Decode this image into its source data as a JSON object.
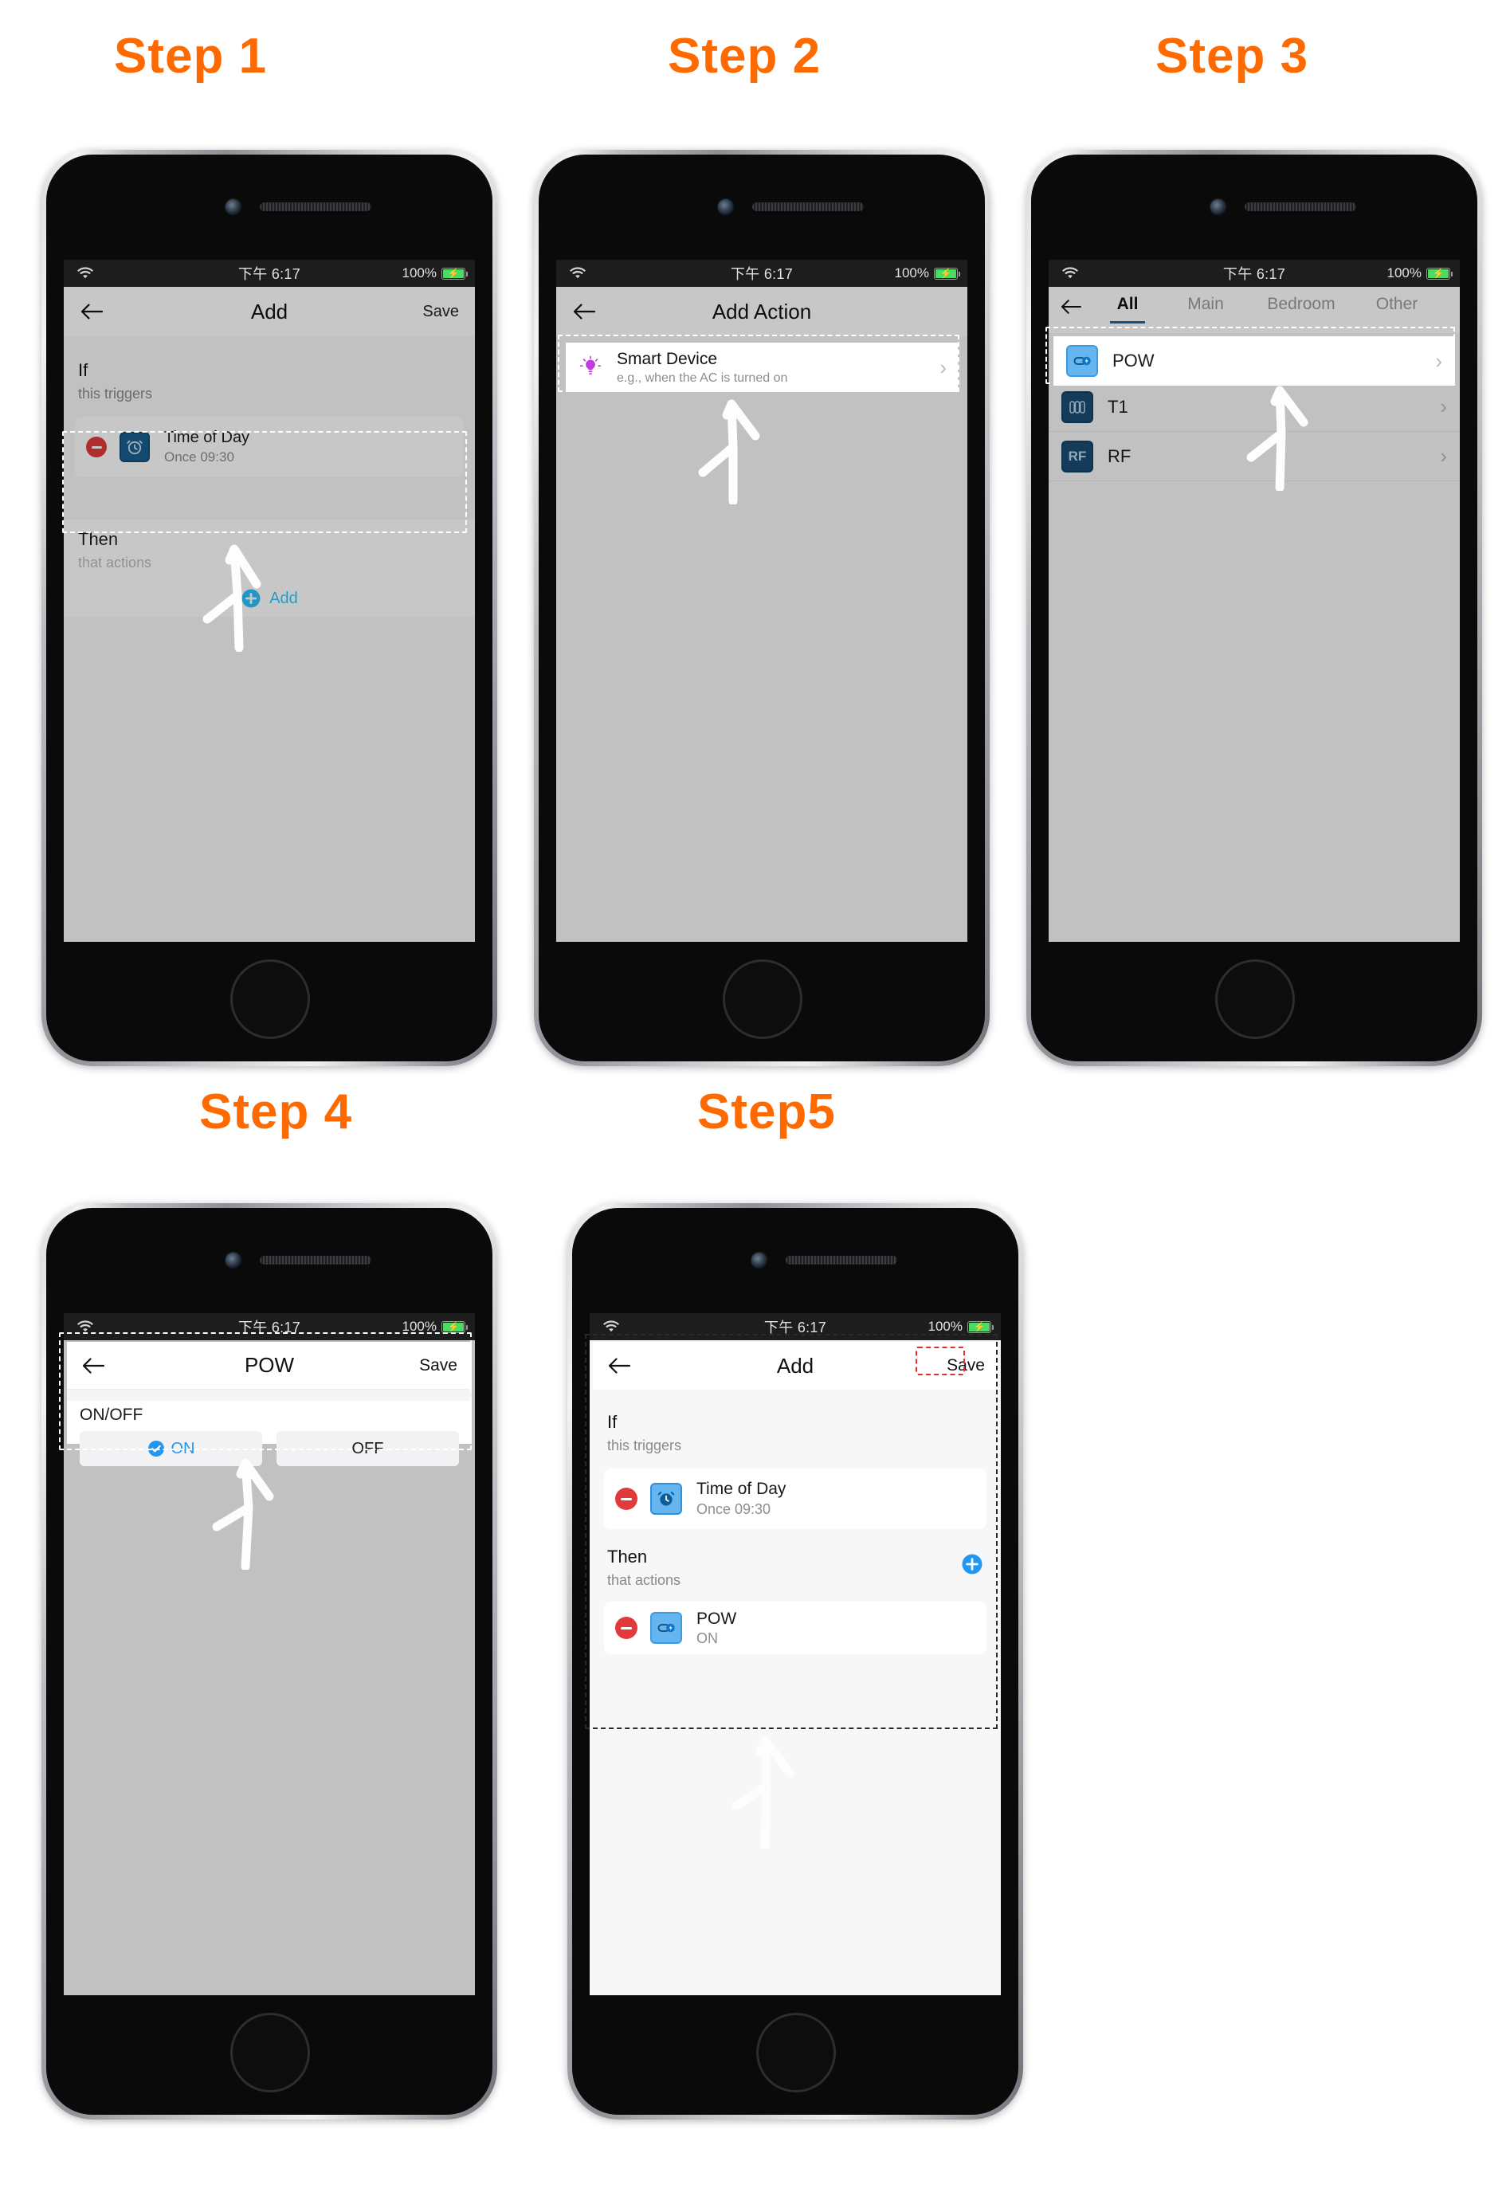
{
  "page": {
    "accent_orange": "#ff6a00",
    "accent_blue": "#2196f3",
    "status_time": "下午 6:17",
    "battery_text": "100%"
  },
  "steps": [
    {
      "id": "step1",
      "title": "Step 1"
    },
    {
      "id": "step2",
      "title": "Step 2"
    },
    {
      "id": "step3",
      "title": "Step 3"
    },
    {
      "id": "step4",
      "title": "Step 4"
    },
    {
      "id": "step5",
      "title": "Step5"
    }
  ],
  "step1": {
    "nav": {
      "title": "Add",
      "save": "Save",
      "back_icon": "back-arrow-icon"
    },
    "if_section": {
      "label": "If",
      "sub": "this triggers"
    },
    "trigger": {
      "title": "Time of Day",
      "subtitle": "Once 09:30",
      "icon": "alarm-clock-icon",
      "remove_icon": "remove-icon"
    },
    "then_section": {
      "label": "Then",
      "sub": "that actions"
    },
    "add_button": {
      "label": "Add",
      "icon": "plus-circle-icon"
    }
  },
  "step2": {
    "nav": {
      "title": "Add Action",
      "back_icon": "back-arrow-icon"
    },
    "item": {
      "title": "Smart Device",
      "subtitle": "e.g., when the AC is turned on",
      "icon": "lightbulb-icon",
      "chevron": "chevron-right-icon"
    }
  },
  "step3": {
    "nav": {
      "back_icon": "back-arrow-icon"
    },
    "tabs": [
      {
        "label": "All",
        "active": true
      },
      {
        "label": "Main",
        "active": false
      },
      {
        "label": "Bedroom",
        "active": false
      },
      {
        "label": "Other",
        "active": false
      }
    ],
    "devices": [
      {
        "name": "POW",
        "icon": "smart-plug-icon",
        "selected": true
      },
      {
        "name": "T1",
        "icon": "wall-switch-icon",
        "selected": false
      },
      {
        "name": "RF",
        "icon": "rf-bridge-icon",
        "selected": false
      }
    ]
  },
  "step4": {
    "nav": {
      "title": "POW",
      "save": "Save",
      "back_icon": "back-arrow-icon"
    },
    "group_label": "ON/OFF",
    "options": [
      {
        "label": "ON",
        "selected": true
      },
      {
        "label": "OFF",
        "selected": false
      }
    ]
  },
  "step5": {
    "nav": {
      "title": "Add",
      "save": "Save",
      "back_icon": "back-arrow-icon"
    },
    "if_section": {
      "label": "If",
      "sub": "this triggers"
    },
    "trigger": {
      "title": "Time of Day",
      "subtitle": "Once 09:30",
      "icon": "alarm-clock-icon",
      "remove_icon": "remove-icon"
    },
    "then_section": {
      "label": "Then",
      "sub": "that actions",
      "add_icon": "plus-circle-icon"
    },
    "action": {
      "title": "POW",
      "subtitle": "ON",
      "icon": "smart-plug-icon",
      "remove_icon": "remove-icon"
    }
  }
}
